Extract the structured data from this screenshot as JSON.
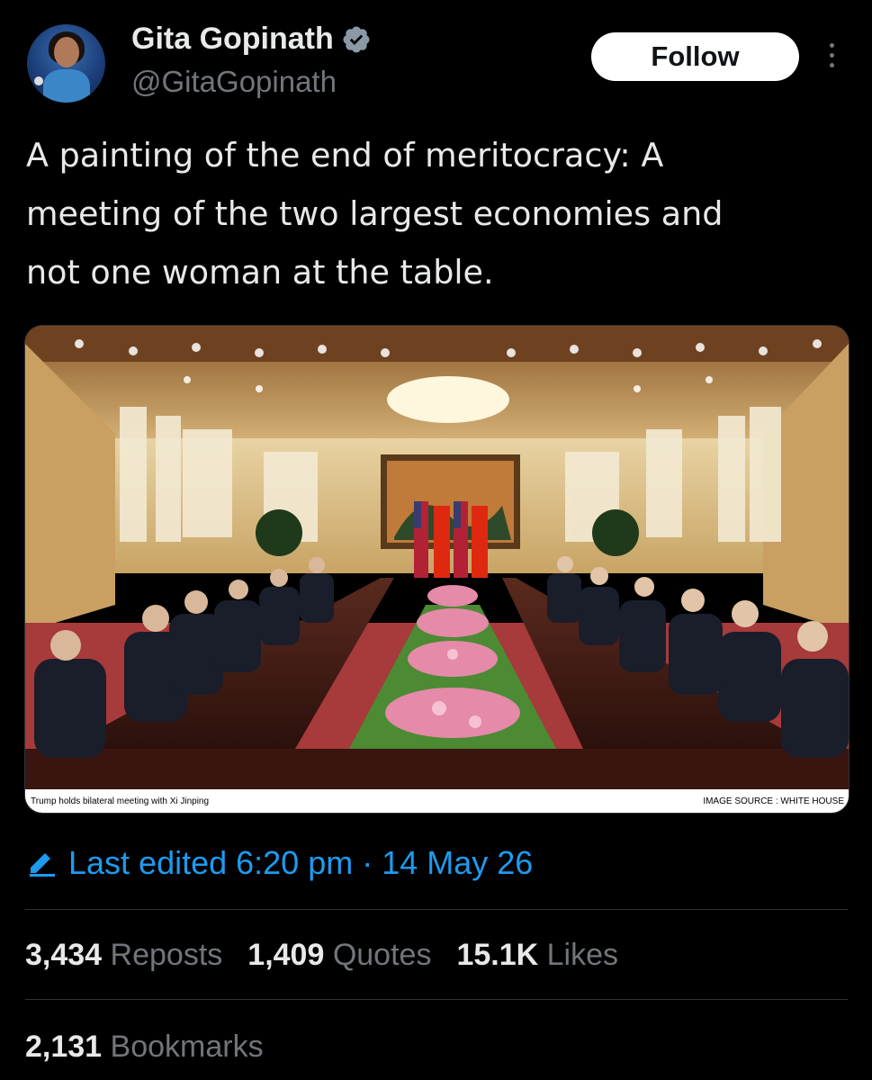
{
  "author": {
    "name": "Gita Gopinath",
    "handle": "@GitaGopinath",
    "verified": true,
    "avatar_icon": "profile-avatar"
  },
  "actions": {
    "follow_label": "Follow",
    "more_icon": "vertical-ellipsis-icon"
  },
  "tweet": {
    "text_lines": [
      "A painting of the end of meritocracy: A",
      "meeting of the two largest economies and",
      "not one woman at the table."
    ]
  },
  "media": {
    "caption_left": "Trump holds bilateral meeting with Xi Jinping",
    "caption_right": "IMAGE SOURCE : WHITE HOUSE"
  },
  "edit": {
    "label": "Last edited 6:20 pm · 14 May 26",
    "icon": "pencil-icon"
  },
  "stats": {
    "reposts_count": "3,434",
    "reposts_label": "Reposts",
    "quotes_count": "1,409",
    "quotes_label": "Quotes",
    "likes_count": "15.1K",
    "likes_label": "Likes",
    "bookmarks_count": "2,131",
    "bookmarks_label": "Bookmarks"
  },
  "colors": {
    "background": "#000000",
    "text": "#e7e9ea",
    "secondary": "#71767b",
    "accent": "#1d9bf0",
    "divider": "#2f3336"
  }
}
